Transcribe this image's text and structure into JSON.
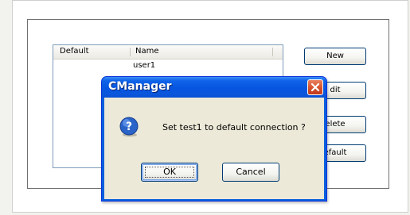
{
  "connection_list": {
    "columns": [
      "Default",
      "Name"
    ],
    "rows": [
      {
        "default": "",
        "name": "user1"
      }
    ]
  },
  "side_buttons": {
    "new_label": "New",
    "edit_label": "dit",
    "delete_label": "elete",
    "default_label": "efault"
  },
  "dialog": {
    "title": "CManager",
    "message": "Set test1 to default connection ?",
    "ok_label": "OK",
    "cancel_label": "Cancel",
    "icon": "question-icon"
  },
  "colors": {
    "titlebar": "#0755e0",
    "close_button": "#d6502b",
    "dialog_body": "#ece9d8"
  }
}
